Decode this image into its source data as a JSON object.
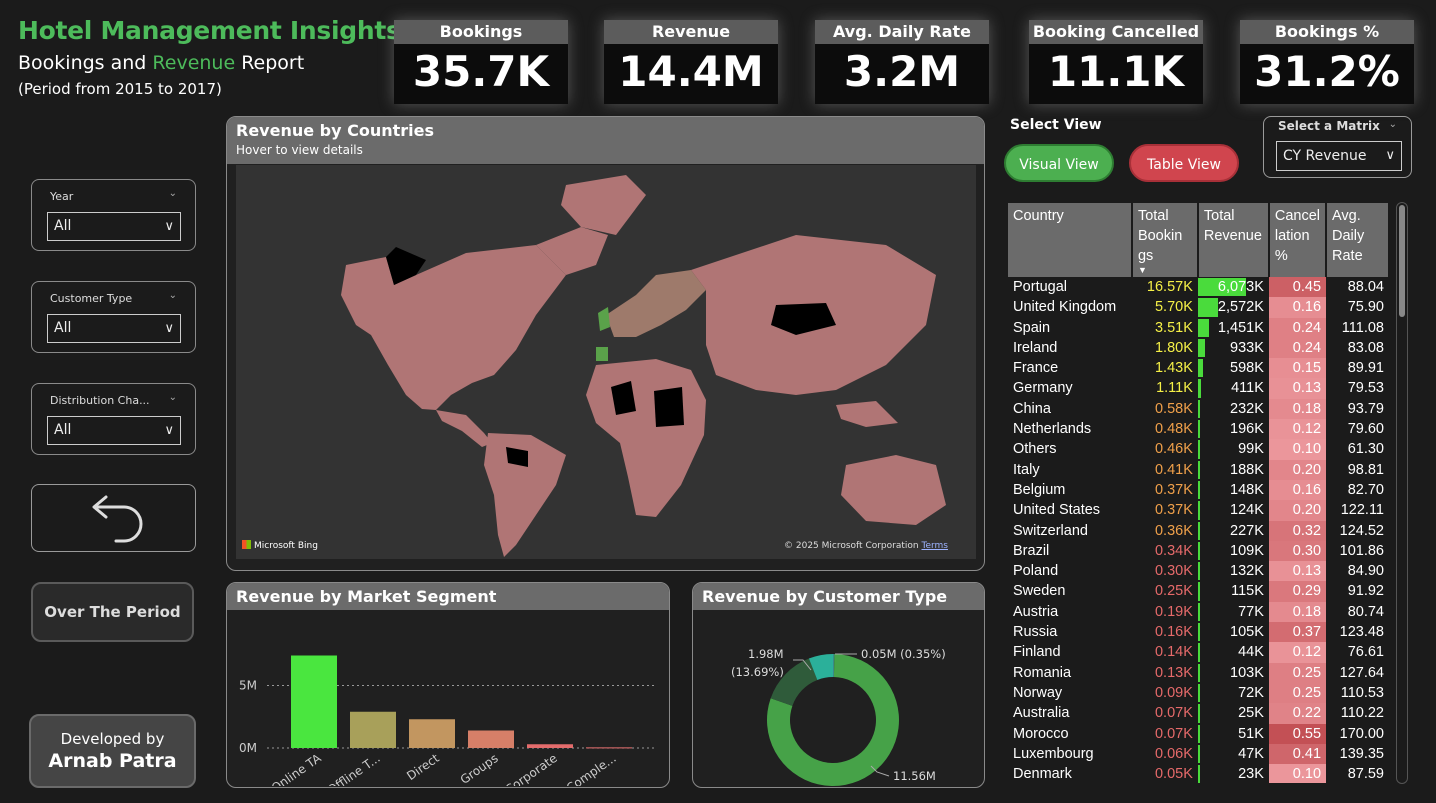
{
  "header": {
    "title": "Hotel Management Insights",
    "subtitle_part1": "Bookings and ",
    "subtitle_accent": "Revenue",
    "subtitle_part2": " Report",
    "period": "(Period from 2015 to 2017)"
  },
  "kpis": [
    {
      "label": "Bookings",
      "value": "35.7K"
    },
    {
      "label": "Revenue",
      "value": "14.4M"
    },
    {
      "label": "Avg. Daily Rate",
      "value": "3.2M"
    },
    {
      "label": "Booking Cancelled",
      "value": "11.1K"
    },
    {
      "label": "Bookings %",
      "value": "31.2%"
    }
  ],
  "filters": [
    {
      "label": "Year",
      "value": "All"
    },
    {
      "label": "Customer Type",
      "value": "All"
    },
    {
      "label": "Distribution Cha...",
      "value": "All"
    }
  ],
  "buttons": {
    "over_period": "Over The Period",
    "developed_by": "Developed by",
    "developer": "Arnab Patra"
  },
  "map": {
    "title": "Revenue by Countries",
    "hint": "Hover to view details",
    "bing": "Microsoft Bing",
    "copyright": "© 2025 Microsoft Corporation",
    "terms": "Terms"
  },
  "view": {
    "select_label": "Select View",
    "visual": "Visual View",
    "table": "Table View",
    "matrix_label": "Select a Matrix",
    "matrix_value": "CY Revenue"
  },
  "table": {
    "headers": [
      "Country",
      "Total Bookin gs",
      "Total Revenue",
      "Cancel lation %",
      "Avg. Daily Rate"
    ],
    "rows": [
      [
        "Portugal",
        "16.57K",
        "6,073K",
        "0.45",
        "88.04"
      ],
      [
        "United Kingdom",
        "5.70K",
        "2,572K",
        "0.16",
        "75.90"
      ],
      [
        "Spain",
        "3.51K",
        "1,451K",
        "0.24",
        "111.08"
      ],
      [
        "Ireland",
        "1.80K",
        "933K",
        "0.24",
        "83.08"
      ],
      [
        "France",
        "1.43K",
        "598K",
        "0.15",
        "89.91"
      ],
      [
        "Germany",
        "1.11K",
        "411K",
        "0.13",
        "79.53"
      ],
      [
        "China",
        "0.58K",
        "232K",
        "0.18",
        "93.79"
      ],
      [
        "Netherlands",
        "0.48K",
        "196K",
        "0.12",
        "79.60"
      ],
      [
        "Others",
        "0.46K",
        "99K",
        "0.10",
        "61.30"
      ],
      [
        "Italy",
        "0.41K",
        "188K",
        "0.20",
        "98.81"
      ],
      [
        "Belgium",
        "0.37K",
        "148K",
        "0.16",
        "82.70"
      ],
      [
        "United States",
        "0.37K",
        "124K",
        "0.20",
        "122.11"
      ],
      [
        "Switzerland",
        "0.36K",
        "227K",
        "0.32",
        "124.52"
      ],
      [
        "Brazil",
        "0.34K",
        "109K",
        "0.30",
        "101.86"
      ],
      [
        "Poland",
        "0.30K",
        "132K",
        "0.13",
        "84.90"
      ],
      [
        "Sweden",
        "0.25K",
        "115K",
        "0.29",
        "91.92"
      ],
      [
        "Austria",
        "0.19K",
        "77K",
        "0.18",
        "80.74"
      ],
      [
        "Russia",
        "0.16K",
        "105K",
        "0.37",
        "123.48"
      ],
      [
        "Finland",
        "0.14K",
        "44K",
        "0.12",
        "76.61"
      ],
      [
        "Romania",
        "0.13K",
        "103K",
        "0.25",
        "127.64"
      ],
      [
        "Norway",
        "0.09K",
        "72K",
        "0.25",
        "110.53"
      ],
      [
        "Australia",
        "0.07K",
        "25K",
        "0.22",
        "110.22"
      ],
      [
        "Morocco",
        "0.07K",
        "51K",
        "0.55",
        "170.00"
      ],
      [
        "Luxembourg",
        "0.06K",
        "47K",
        "0.41",
        "139.35"
      ],
      [
        "Denmark",
        "0.05K",
        "23K",
        "0.10",
        "87.59"
      ]
    ]
  },
  "chart_data": [
    {
      "type": "bar",
      "title": "Revenue by Market Segment",
      "categories": [
        "Online TA",
        "Offline T...",
        "Direct",
        "Groups",
        "Corporate",
        "Comple..."
      ],
      "values": [
        7.4,
        2.9,
        2.3,
        1.4,
        0.3,
        0.05
      ],
      "colors": [
        "#4ae63f",
        "#a8a05a",
        "#c29660",
        "#d67f68",
        "#e46c6c",
        "#e87070"
      ],
      "ylabel": "",
      "yticks": [
        "0M",
        "5M"
      ],
      "ylim": [
        0,
        8
      ]
    },
    {
      "type": "pie",
      "title": "Revenue by Customer Type",
      "slices": [
        {
          "value": 11.56,
          "label": "11.56M",
          "pct": "(80.01%)",
          "color": "#46a248"
        },
        {
          "value": 1.98,
          "label": "1.98M",
          "pct": "(13.69%)",
          "color": "#2f5b3a"
        },
        {
          "value": 0.86,
          "label": "",
          "pct": "",
          "color": "#2bb09a"
        },
        {
          "value": 0.05,
          "label": "0.05M",
          "pct": "(0.35%)",
          "color": "#3a8a8a"
        }
      ]
    }
  ],
  "colors": {
    "accent": "#4dbb5b",
    "visual_btn": "#4caf50",
    "table_btn": "#d0454e"
  }
}
